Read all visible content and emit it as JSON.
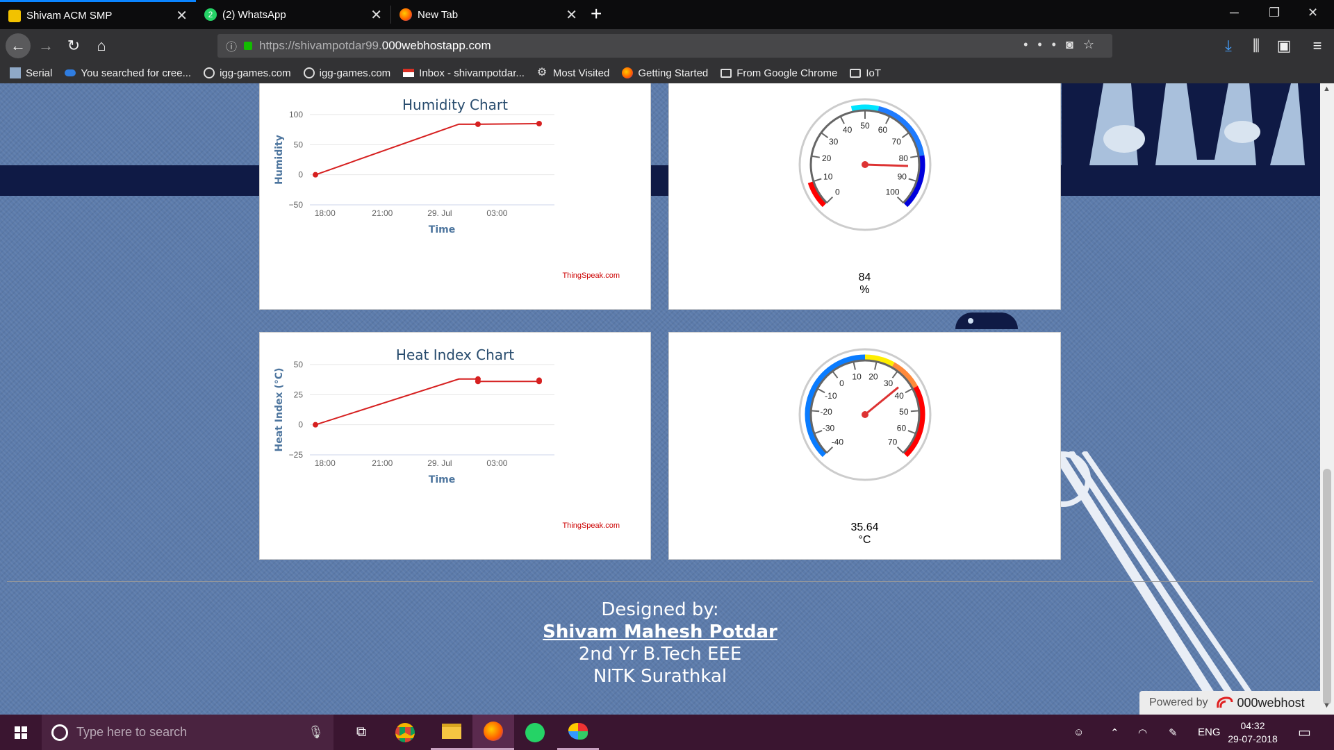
{
  "tabs": [
    {
      "title": "Shivam ACM SMP",
      "icon": "pokemon-favicon",
      "active": true
    },
    {
      "title": "(2) WhatsApp",
      "icon": "whatsapp-favicon",
      "badge": "2",
      "active": false
    },
    {
      "title": "New Tab",
      "icon": "firefox-favicon",
      "active": false
    }
  ],
  "url": {
    "prefix": "https://shivampotdar99.",
    "domain": "000webhostapp.com"
  },
  "bookmarks": [
    {
      "label": "Serial",
      "icon": "serial-icon"
    },
    {
      "label": "You searched for cree...",
      "icon": "gamepad-icon"
    },
    {
      "label": "igg-games.com",
      "icon": "globe-icon"
    },
    {
      "label": "igg-games.com",
      "icon": "globe-icon"
    },
    {
      "label": "Inbox - shivampotdar...",
      "icon": "gmail-icon"
    },
    {
      "label": "Most Visited",
      "icon": "gear-icon"
    },
    {
      "label": "Getting Started",
      "icon": "firefox-icon"
    },
    {
      "label": "From Google Chrome",
      "icon": "folder-icon"
    },
    {
      "label": "IoT",
      "icon": "folder-icon"
    }
  ],
  "humidity_chart": {
    "title": "Humidity Chart",
    "ylabel": "Humidity",
    "xlabel": "Time",
    "credit": "ThingSpeak.com"
  },
  "heat_chart": {
    "title": "Heat Index Chart",
    "ylabel": "Heat Index (°C)",
    "xlabel": "Time",
    "credit": "ThingSpeak.com"
  },
  "humidity_gauge": {
    "value": "84",
    "unit": "%"
  },
  "heat_gauge": {
    "value": "35.64",
    "unit": "°C"
  },
  "footer": {
    "designed_by": "Designed by:",
    "name": "Shivam Mahesh Potdar",
    "course": "2nd Yr B.Tech EEE",
    "college": "NITK Surathkal"
  },
  "powered": {
    "label": "Powered by",
    "brand": "000webhost"
  },
  "taskbar": {
    "search_placeholder": "Type here to search",
    "language": "ENG",
    "time": "04:32",
    "date": "29-07-2018"
  },
  "chart_data": [
    {
      "type": "line",
      "title": "Humidity Chart",
      "xlabel": "Time",
      "ylabel": "Humidity",
      "xticks": [
        "18:00",
        "21:00",
        "29. Jul",
        "03:00"
      ],
      "yticks": [
        -50,
        0,
        50,
        100
      ],
      "ylim": [
        -50,
        100
      ],
      "x_hours": [
        17.5,
        25,
        26.0,
        29.2
      ],
      "values": [
        0,
        84,
        84,
        85
      ],
      "point_markers": [
        true,
        false,
        true,
        true
      ],
      "color": "#d62020",
      "grid": true,
      "legend": "none"
    },
    {
      "type": "line",
      "title": "Heat Index Chart",
      "xlabel": "Time",
      "ylabel": "Heat Index (°C)",
      "xticks": [
        "18:00",
        "21:00",
        "29. Jul",
        "03:00"
      ],
      "yticks": [
        -25,
        0,
        25,
        50
      ],
      "ylim": [
        -25,
        50
      ],
      "x_hours": [
        17.5,
        25,
        26.0,
        26.0,
        29.2,
        29.2
      ],
      "values": [
        0,
        38,
        38,
        36,
        36,
        37
      ],
      "point_markers": [
        true,
        false,
        true,
        true,
        true,
        true
      ],
      "color": "#d62020",
      "grid": true,
      "legend": "none"
    },
    {
      "type": "gauge",
      "min": 0,
      "max": 100,
      "ticks": [
        0,
        10,
        20,
        30,
        40,
        50,
        60,
        70,
        80,
        90,
        100
      ],
      "value": 84,
      "unit": "%",
      "bands": [
        {
          "from": 0,
          "to": 10,
          "color": "#ff0000"
        },
        {
          "from": 45,
          "to": 55,
          "color": "#00e5ff"
        },
        {
          "from": 55,
          "to": 80,
          "color": "#1e7bff"
        },
        {
          "from": 80,
          "to": 100,
          "color": "#0000dd"
        }
      ]
    },
    {
      "type": "gauge",
      "min": -40,
      "max": 70,
      "ticks": [
        -40,
        -30,
        -20,
        -10,
        0,
        10,
        20,
        30,
        40,
        50,
        60,
        70
      ],
      "value": 35.64,
      "unit": "°C",
      "bands": [
        {
          "from": -40,
          "to": 15,
          "color": "#0a7cff"
        },
        {
          "from": 15,
          "to": 27,
          "color": "#ffee00"
        },
        {
          "from": 27,
          "to": 40,
          "color": "#ff8a3a"
        },
        {
          "from": 40,
          "to": 70,
          "color": "#ff0000"
        }
      ]
    }
  ]
}
